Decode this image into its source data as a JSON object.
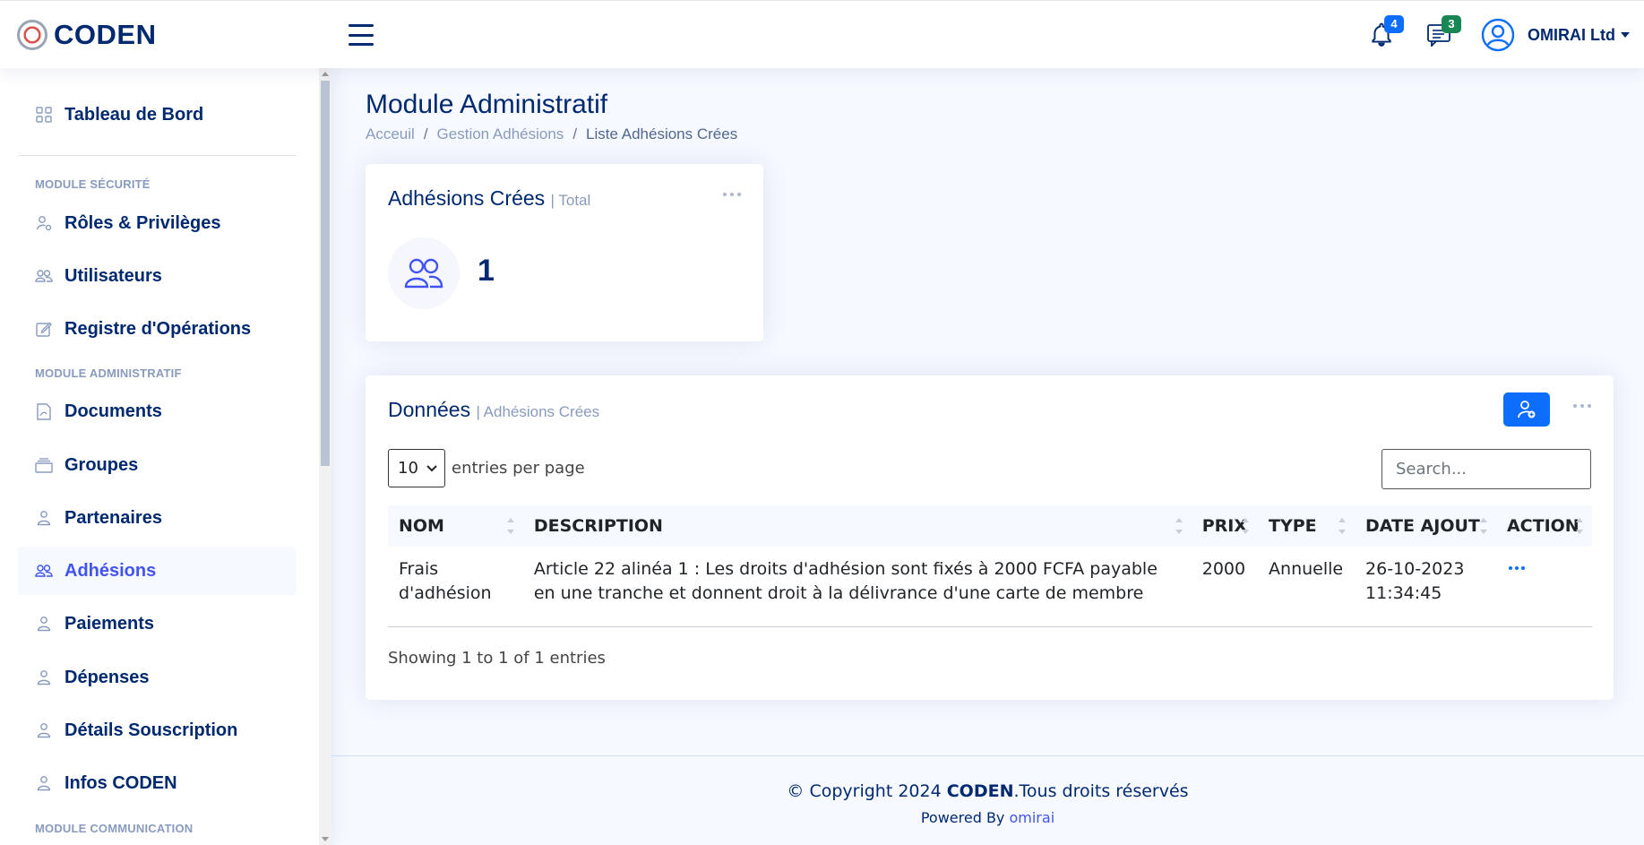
{
  "app": {
    "name": "CODEN"
  },
  "header": {
    "notifications_count": "4",
    "messages_count": "3",
    "profile_name": "OMIRAI Ltd",
    "colors": {
      "notif_badge": "#0d6efd",
      "msg_badge": "#198754",
      "primary": "#012970"
    }
  },
  "sidebar": {
    "dashboard": "Tableau de Bord",
    "heading_security": "MODULE SÉCURITÉ",
    "roles": "Rôles & Privilèges",
    "users": "Utilisateurs",
    "registry": "Registre d'Opérations",
    "heading_admin": "MODULE ADMINISTRATIF",
    "documents": "Documents",
    "groups": "Groupes",
    "partners": "Partenaires",
    "adhesions": "Adhésions",
    "payments": "Paiements",
    "expenses": "Dépenses",
    "subscription": "Détails Souscription",
    "infos": "Infos CODEN",
    "heading_comm": "MODULE COMMUNICATION",
    "active_item": "Adhésions"
  },
  "page": {
    "title": "Module Administratif",
    "breadcrumb": [
      "Acceuil",
      "Gestion Adhésions",
      "Liste Adhésions Crées"
    ]
  },
  "stat_card": {
    "title": "Adhésions Crées",
    "subtitle": "| Total",
    "value": "1"
  },
  "data_card": {
    "title": "Données",
    "subtitle": "| Adhésions Crées",
    "page_size": "10",
    "entries_label": "entries per page",
    "search_placeholder": "Search...",
    "columns": [
      "NOM",
      "DESCRIPTION",
      "PRIX",
      "TYPE",
      "DATE AJOUT",
      "ACTION"
    ],
    "rows": [
      {
        "nom": "Frais d'adhésion",
        "description": "Article 22 alinéa 1 : Les droits d'adhésion sont fixés à 2000 FCFA payable en une tranche et donnent droit à la délivrance d'une carte de membre",
        "prix": "2000",
        "type": "Annuelle",
        "date": "26-10-2023 11:34:45"
      }
    ],
    "showing": "Showing 1 to 1 of 1 entries"
  },
  "footer": {
    "copy_prefix": "© Copyright 2024 ",
    "copy_brand": "CODEN",
    "copy_suffix": ".Tous droits réservés",
    "powered_prefix": "Powered By ",
    "powered_link": "omirai"
  }
}
